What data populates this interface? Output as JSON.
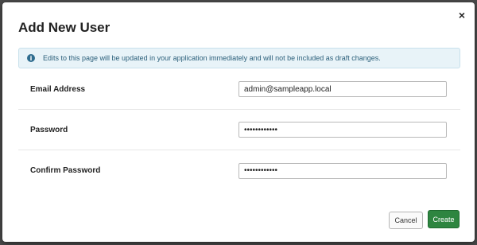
{
  "dialog": {
    "title": "Add New User",
    "close_glyph": "×"
  },
  "alert": {
    "icon": "info-icon",
    "text": "Edits to this page will be updated in your application immediately and will not be included as draft changes."
  },
  "fields": {
    "email": {
      "label": "Email Address",
      "value": "admin@sampleapp.local"
    },
    "password": {
      "label": "Password",
      "value": "••••••••••••"
    },
    "confirm_password": {
      "label": "Confirm Password",
      "value": "••••••••••••"
    }
  },
  "buttons": {
    "cancel": "Cancel",
    "create": "Create"
  },
  "colors": {
    "create_button": "#2e8540",
    "alert_background": "#e8f3f8",
    "alert_text": "#2b5f7a"
  }
}
